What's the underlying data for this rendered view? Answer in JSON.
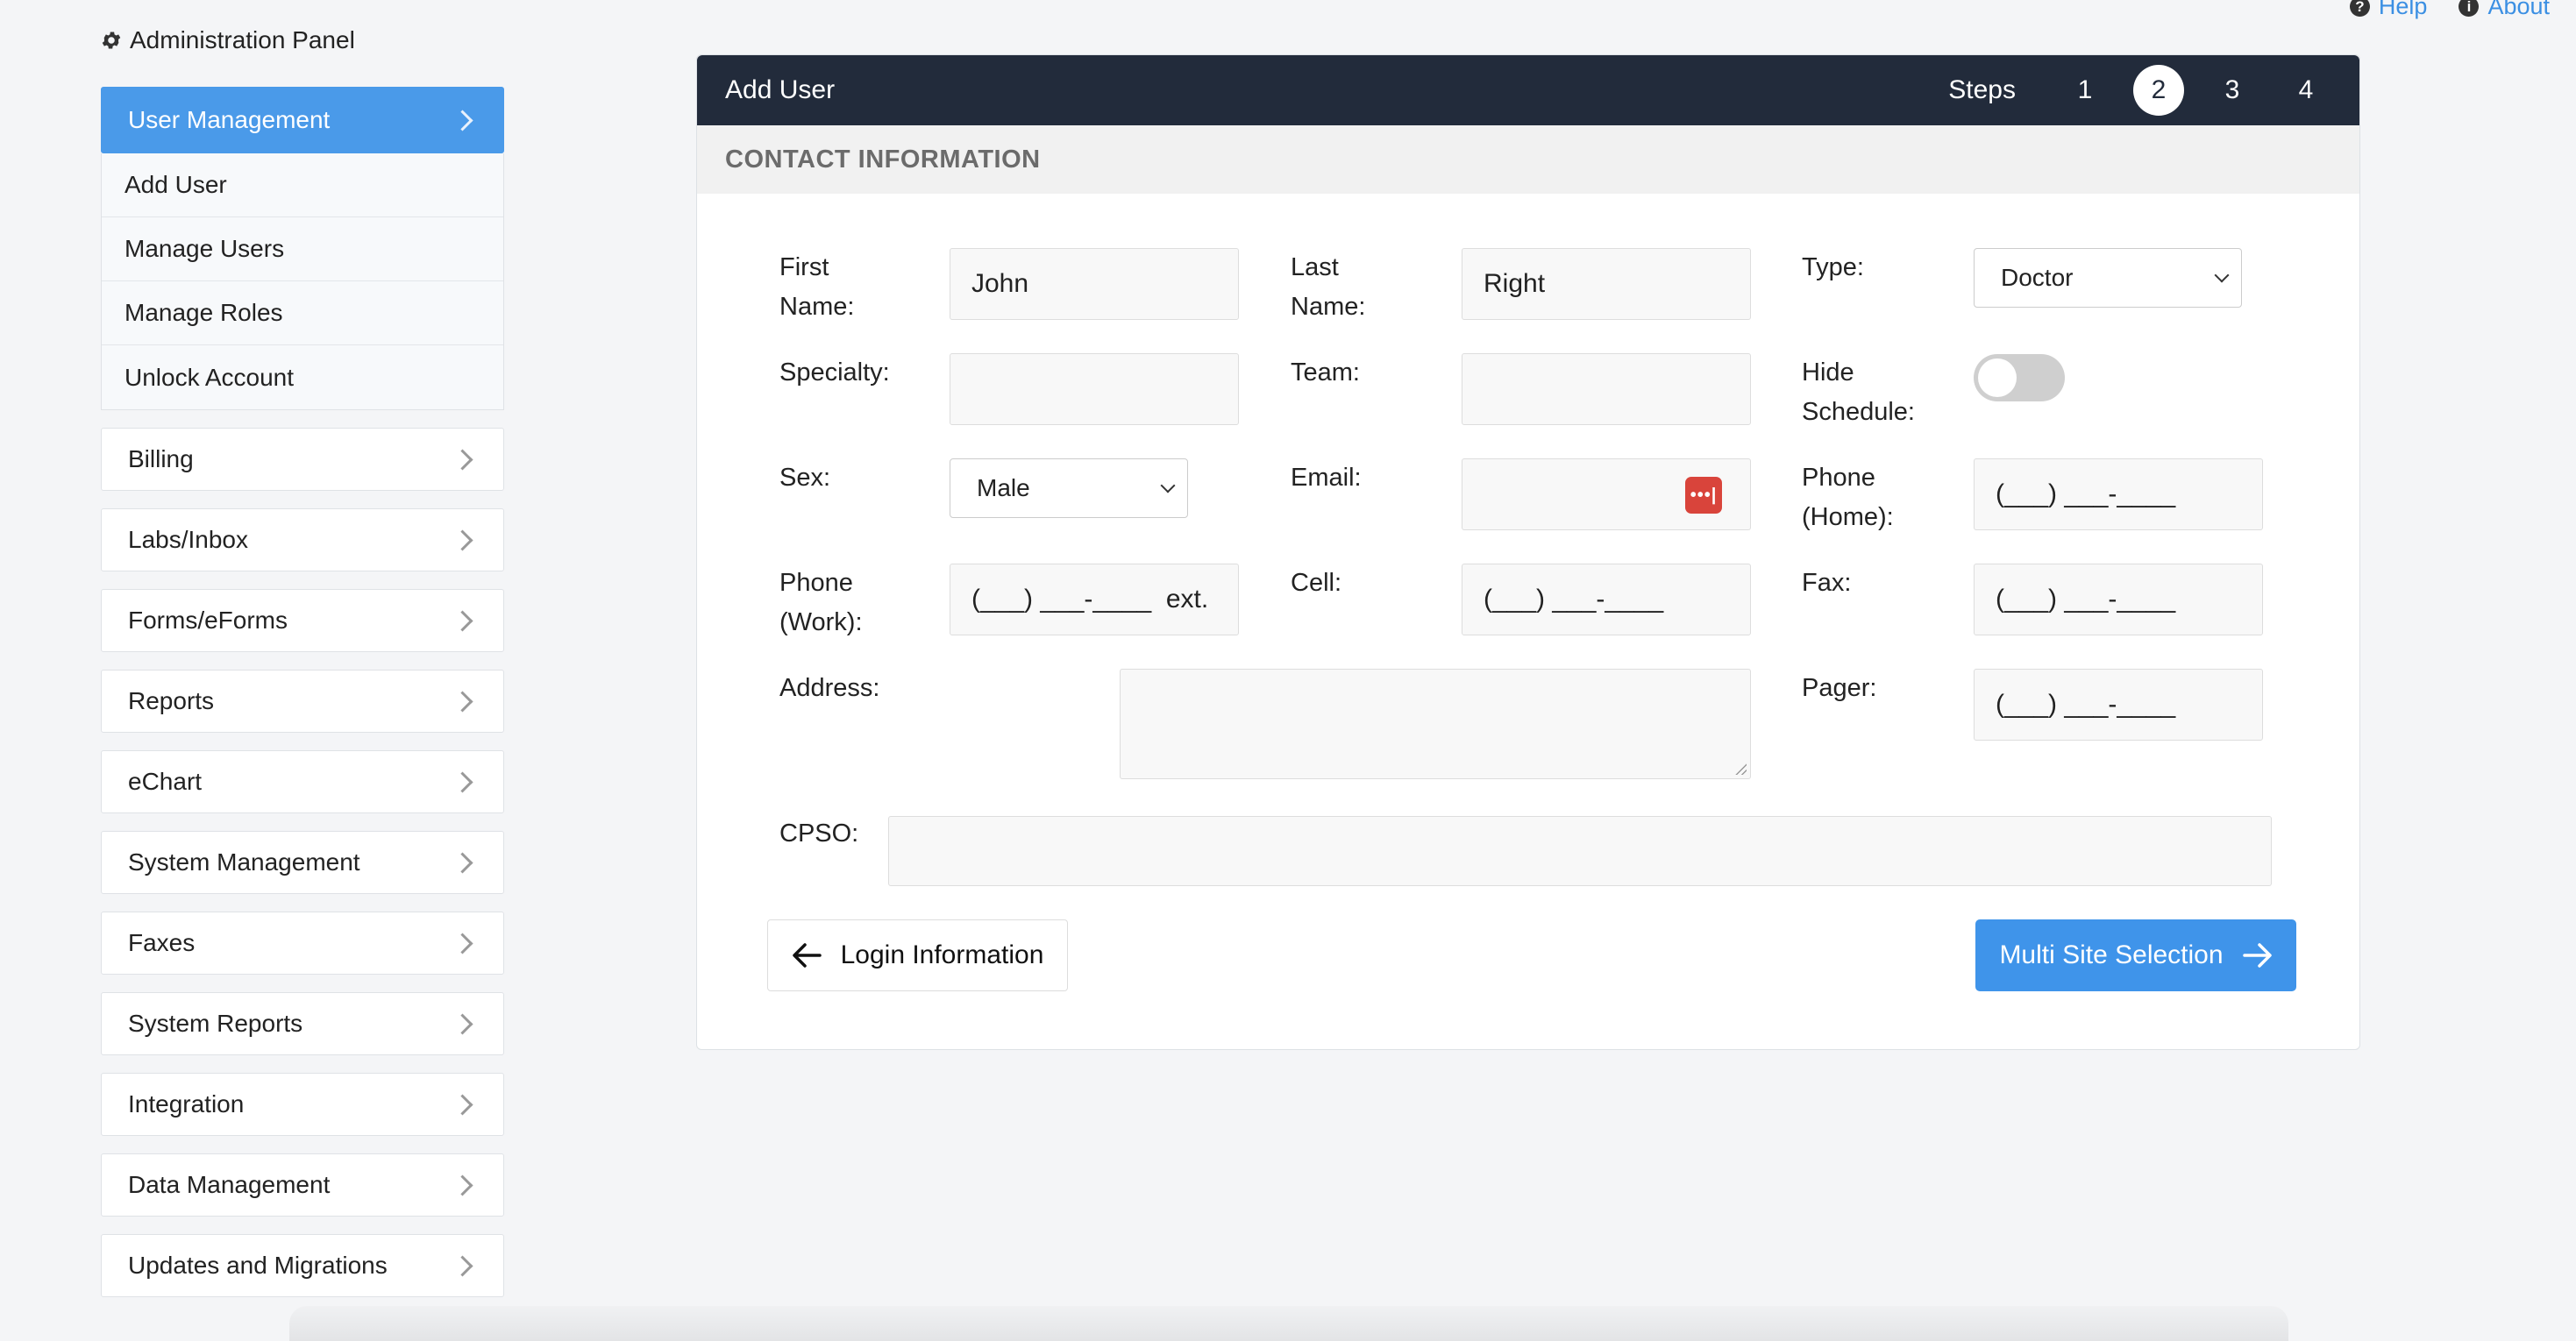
{
  "toplinks": {
    "help": "Help",
    "about": "About"
  },
  "sidebar": {
    "title": "Administration Panel",
    "active": "User Management",
    "sub_items": [
      "Add User",
      "Manage Users",
      "Manage Roles",
      "Unlock Account"
    ],
    "items": [
      "Billing",
      "Labs/Inbox",
      "Forms/eForms",
      "Reports",
      "eChart",
      "System Management",
      "Faxes",
      "System Reports",
      "Integration",
      "Data Management",
      "Updates and Migrations"
    ]
  },
  "card": {
    "title": "Add User",
    "steps_label": "Steps",
    "steps": [
      "1",
      "2",
      "3",
      "4"
    ],
    "current_step": "2",
    "section": "CONTACT INFORMATION"
  },
  "form": {
    "first_name_label": "First Name:",
    "first_name": "John",
    "last_name_label": "Last Name:",
    "last_name": "Right",
    "type_label": "Type:",
    "type_value": "Doctor",
    "specialty_label": "Specialty:",
    "specialty": "",
    "team_label": "Team:",
    "team": "",
    "hide_schedule_label": "Hide Schedule:",
    "hide_schedule": false,
    "sex_label": "Sex:",
    "sex_value": "Male",
    "email_label": "Email:",
    "email": "",
    "phone_home_label": "Phone (Home):",
    "phone_home": "(___) ___-____",
    "phone_work_label": "Phone (Work):",
    "phone_work": "(___) ___-____  ext.",
    "cell_label": "Cell:",
    "cell": "(___) ___-____",
    "fax_label": "Fax:",
    "fax": "(___) ___-____",
    "address_label": "Address:",
    "address": "",
    "pager_label": "Pager:",
    "pager": "(___) ___-____",
    "cpso_label": "CPSO:",
    "cpso": ""
  },
  "buttons": {
    "back": "Login Information",
    "next": "Multi Site Selection"
  }
}
